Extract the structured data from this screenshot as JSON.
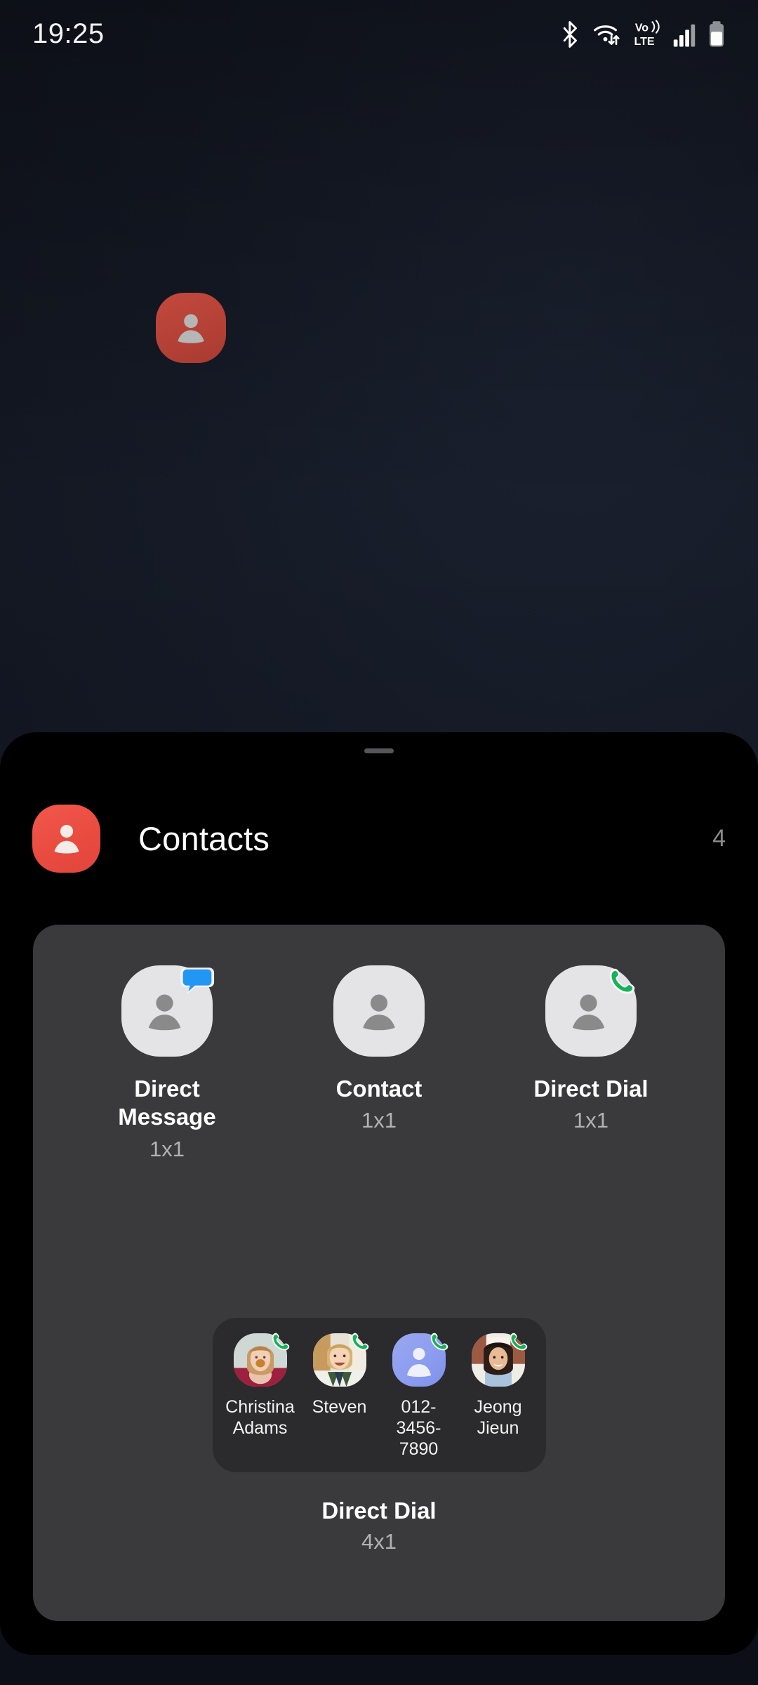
{
  "status_bar": {
    "time": "19:25",
    "icons": [
      "bluetooth-icon",
      "wifi-icon",
      "volte-icon",
      "signal-icon",
      "battery-icon"
    ],
    "volte_top": "Vo))",
    "volte_bottom": "LTE"
  },
  "home_screen": {
    "app_icon_name": "contacts-app-icon",
    "app_icon_color": "#b8433a"
  },
  "sheet": {
    "handle_name": "drag-handle",
    "app_name": "Contacts",
    "app_icon_color": "#ed4c41",
    "widget_count": "4"
  },
  "widgets": [
    {
      "label": "Direct Message",
      "size": "1x1",
      "icon": "person-message-icon",
      "badge": "speech-bubble-badge",
      "badge_color": "#2196f3"
    },
    {
      "label": "Contact",
      "size": "1x1",
      "icon": "person-icon",
      "badge": null,
      "badge_color": null
    },
    {
      "label": "Direct Dial",
      "size": "1x1",
      "icon": "person-phone-icon",
      "badge": "phone-badge",
      "badge_color": "#18b25a"
    }
  ],
  "preview_widget": {
    "label": "Direct Dial",
    "size": "4x1",
    "contacts": [
      {
        "name": "Christina Adams",
        "avatar": "photo-woman-cookie",
        "badge": "phone-badge"
      },
      {
        "name": "Steven",
        "avatar": "photo-boy-striped-shirt",
        "badge": "phone-badge"
      },
      {
        "name": "012-3456-7890",
        "avatar": "default-avatar-blue",
        "badge": "phone-badge"
      },
      {
        "name": "Jeong Jieun",
        "avatar": "photo-woman-denim",
        "badge": "phone-badge"
      }
    ]
  }
}
